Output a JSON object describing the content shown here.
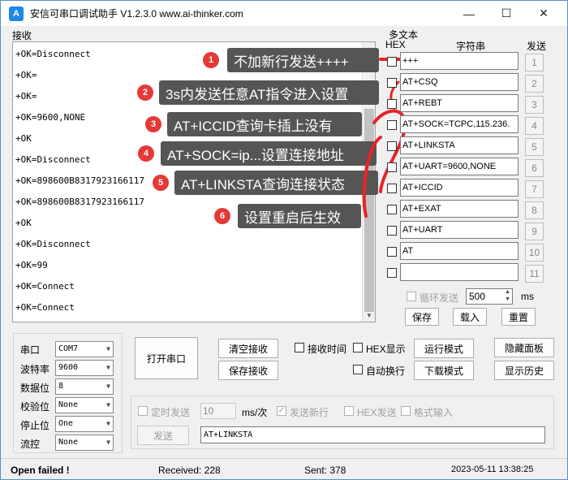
{
  "window": {
    "title": "安信可串口调试助手 V1.2.3.0    www.ai-thinker.com",
    "icon_glyph": "A",
    "minimize_glyph": "—",
    "maximize_glyph": "☐",
    "close_glyph": "✕"
  },
  "receive": {
    "label": "接收",
    "lines": [
      "+OK=Disconnect",
      "+OK=",
      "+OK=",
      "+OK=9600,NONE",
      "+OK",
      "+OK=Disconnect",
      "+OK=898600B8317923166117",
      "+OK=898600B8317923166117",
      "+OK",
      "+OK=Disconnect",
      "+OK=99",
      "+OK=Connect",
      "+OK=Connect"
    ],
    "scroll_up_glyph": "▲",
    "scroll_down_glyph": "▼"
  },
  "annotations": [
    {
      "num": "1",
      "text": "不加新行发送++++"
    },
    {
      "num": "2",
      "text": "3s内发送任意AT指令进入设置"
    },
    {
      "num": "3",
      "text": "AT+ICCID查询卡插上没有"
    },
    {
      "num": "4",
      "text": "AT+SOCK=ip...设置连接地址"
    },
    {
      "num": "5",
      "text": "AT+LINKSTA查询连接状态"
    },
    {
      "num": "6",
      "text": "设置重启后生效"
    }
  ],
  "multi_text": {
    "title": "多文本",
    "col_hex": "HEX",
    "col_string": "字符串",
    "col_send": "发送",
    "rows": [
      {
        "value": "+++",
        "num": "1"
      },
      {
        "value": "AT+CSQ",
        "num": "2"
      },
      {
        "value": "AT+REBT",
        "num": "3"
      },
      {
        "value": "AT+SOCK=TCPC,115.236.",
        "num": "4"
      },
      {
        "value": "AT+LINKSTA",
        "num": "5"
      },
      {
        "value": "AT+UART=9600,NONE",
        "num": "6"
      },
      {
        "value": "AT+ICCID",
        "num": "7"
      },
      {
        "value": "AT+EXAT",
        "num": "8"
      },
      {
        "value": "AT+UART",
        "num": "9"
      },
      {
        "value": "AT",
        "num": "10"
      },
      {
        "value": "",
        "num": "11"
      }
    ],
    "loop_label": "循环发送",
    "loop_value": "500",
    "loop_unit": "ms",
    "save_label": "保存",
    "load_label": "载入",
    "reset_label": "重置"
  },
  "serial": {
    "port_label": "串口",
    "port_value": "COM7",
    "baud_label": "波特率",
    "baud_value": "9600",
    "data_label": "数据位",
    "data_value": "8",
    "check_label": "校验位",
    "check_value": "None",
    "stop_label": "停止位",
    "stop_value": "One",
    "flow_label": "流控",
    "flow_value": "None",
    "open_label": "打开串口"
  },
  "controls": {
    "clear_recv": "清空接收",
    "save_recv": "保存接收",
    "recv_time": "接收时间",
    "hex_display": "HEX显示",
    "auto_wrap": "自动换行",
    "run_mode": "运行模式",
    "download_mode": "下载模式",
    "hide_panel": "隐藏面板",
    "show_history": "显示历史"
  },
  "send": {
    "timed_send": "定时发送",
    "interval_value": "10",
    "interval_unit": "ms/次",
    "send_newline": "发送新行",
    "hex_send": "HEX发送",
    "format_input": "格式输入",
    "send_button": "发送",
    "input_value": "AT+LINKSTA"
  },
  "status": {
    "message": "Open failed !",
    "received": "Received: 228",
    "sent": "Sent: 378",
    "datetime": "2023-05-11 13:38:25"
  }
}
